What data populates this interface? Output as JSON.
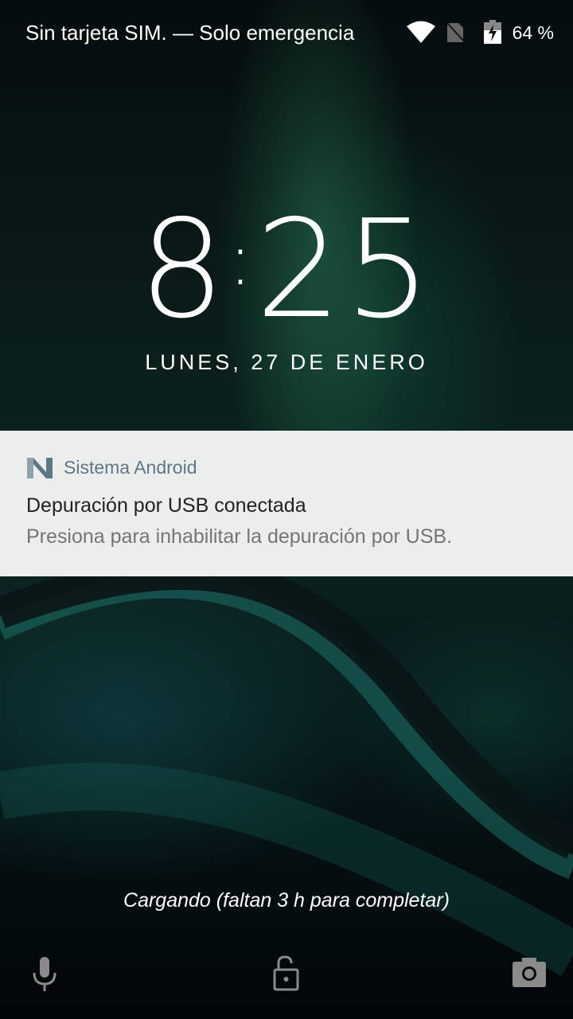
{
  "status_bar": {
    "carrier": "Sin tarjeta SIM. — Solo emergencia",
    "battery_percent": "64 %",
    "icons": [
      "wifi-icon",
      "no-sim-icon",
      "battery-charging-icon"
    ]
  },
  "clock": {
    "hours": "8",
    "minutes": "25"
  },
  "date": "LUNES, 27 DE ENERO",
  "notification": {
    "app": "Sistema Android",
    "title": "Depuración por USB conectada",
    "text": "Presiona para inhabilitar la depuración por USB."
  },
  "charging_status": "Cargando (faltan 3 h para completar)",
  "shortcuts": [
    "mic-icon",
    "unlock-icon",
    "camera-icon"
  ],
  "colors": {
    "notification_bg": "#eceeed",
    "app_name": "#5e7785",
    "icon_gray": "#8a8a8a"
  }
}
